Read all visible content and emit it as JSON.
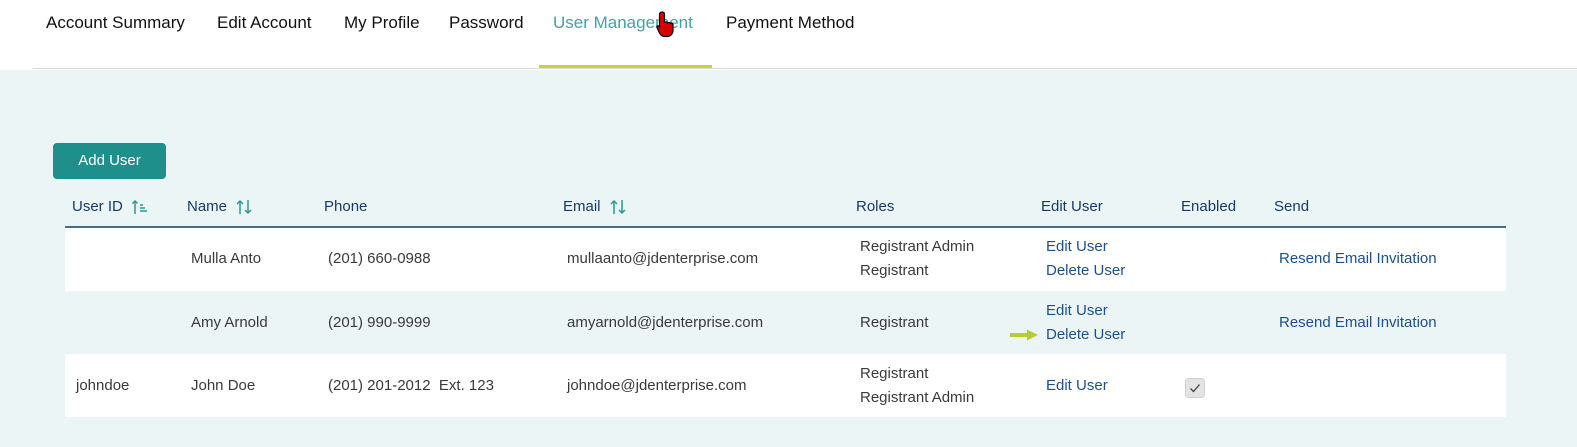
{
  "tabs": [
    {
      "label": "Account Summary",
      "active": false
    },
    {
      "label": "Edit Account",
      "active": false
    },
    {
      "label": "My Profile",
      "active": false
    },
    {
      "label": "Password",
      "active": false
    },
    {
      "label": "User Management",
      "active": true
    },
    {
      "label": "Payment Method",
      "active": false
    }
  ],
  "add_user_label": "Add User",
  "table": {
    "columns": {
      "user_id": "User ID",
      "name": "Name",
      "phone": "Phone",
      "email": "Email",
      "roles": "Roles",
      "edit_user": "Edit User",
      "enabled": "Enabled",
      "send": "Send"
    },
    "rows": [
      {
        "user_id": "",
        "name": "Mulla Anto",
        "phone": "(201) 660-0988",
        "email": "mullaanto@jdenterprise.com",
        "roles": [
          "Registrant Admin",
          "Registrant"
        ],
        "edit_label": "Edit User",
        "delete_label": "Delete User",
        "enabled": false,
        "send_label": "Resend Email Invitation"
      },
      {
        "user_id": "",
        "name": "Amy Arnold",
        "phone": "(201) 990-9999",
        "email": "amyarnold@jdenterprise.com",
        "roles": [
          "Registrant"
        ],
        "edit_label": "Edit User",
        "delete_label": "Delete User",
        "enabled": false,
        "send_label": "Resend Email Invitation"
      },
      {
        "user_id": "johndoe",
        "name": "John Doe",
        "phone": "(201) 201-2012  Ext. 123",
        "email": "johndoe@jdenterprise.com",
        "roles": [
          "Registrant",
          "Registrant Admin"
        ],
        "edit_label": "Edit User",
        "enabled": true
      }
    ]
  },
  "icons": {
    "cursor": "hand-pointer-icon",
    "sort": "sort-arrows-icon",
    "sort_active": "sort-ascending-icon",
    "arrow": "arrow-right-icon",
    "check": "check-icon"
  },
  "colors": {
    "accent": "#1f8f8c",
    "active_tab": "#4a9ea6",
    "tab_underline": "#c5d631",
    "link": "#1e4f8c",
    "header_text": "#163b66",
    "background": "#ebf5f5"
  }
}
